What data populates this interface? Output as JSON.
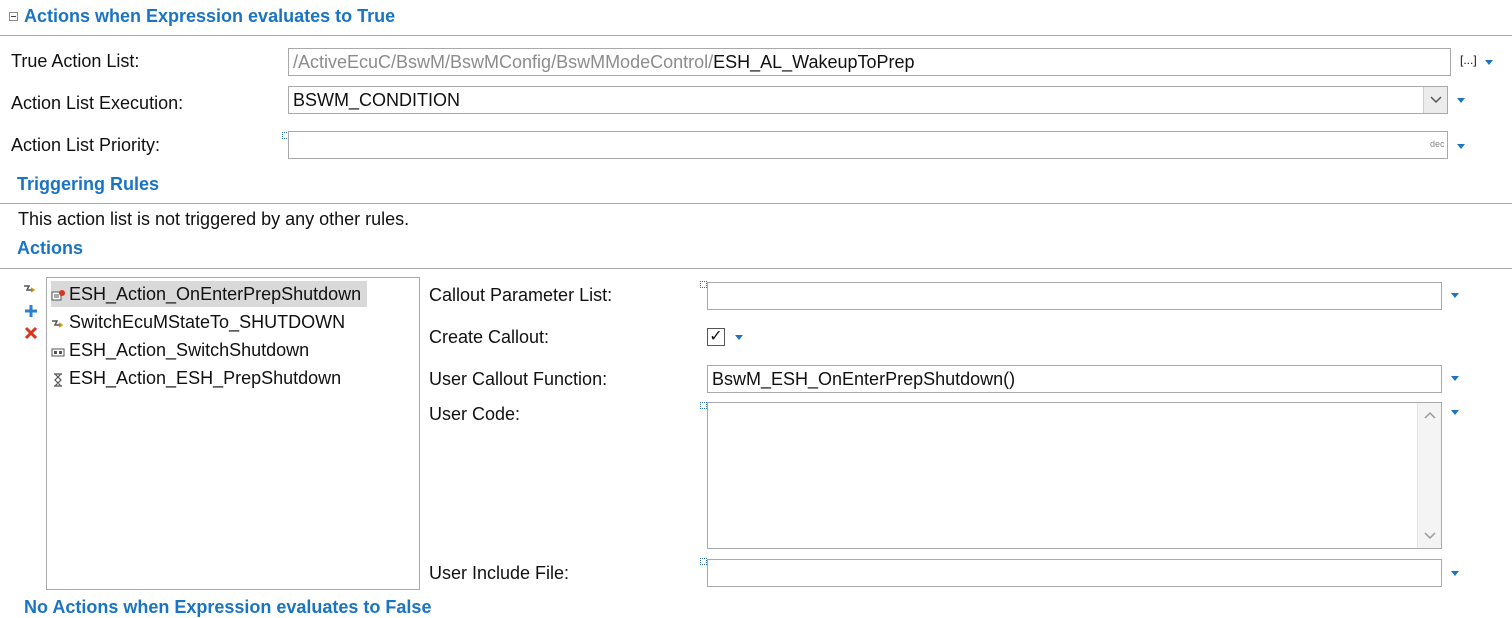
{
  "section_true": {
    "title": "Actions when Expression evaluates to True"
  },
  "true_action_list": {
    "label": "True Action List:",
    "path_prefix": "/ActiveEcuC/BswM/BswMConfig/BswMModeControl/",
    "path_value": "ESH_AL_WakeupToPrep",
    "browse": "[...]"
  },
  "action_list_execution": {
    "label": "Action List Execution:",
    "value": "BSWM_CONDITION"
  },
  "action_list_priority": {
    "label": "Action List Priority:",
    "value": "",
    "format": "dec"
  },
  "triggering_rules": {
    "title": "Triggering Rules",
    "text": "This action list is not triggered by any other rules."
  },
  "actions": {
    "title": "Actions",
    "items": [
      {
        "label": "ESH_Action_OnEnterPrepShutdown",
        "icon": "callout-icon",
        "selected": true
      },
      {
        "label": "SwitchEcuMStateTo_SHUTDOWN",
        "icon": "switch-action-icon",
        "selected": false
      },
      {
        "label": "ESH_Action_SwitchShutdown",
        "icon": "component-icon",
        "selected": false
      },
      {
        "label": "ESH_Action_ESH_PrepShutdown",
        "icon": "hourglass-icon",
        "selected": false
      }
    ]
  },
  "details": {
    "callout_parameter_list": {
      "label": "Callout Parameter List:",
      "value": ""
    },
    "create_callout": {
      "label": "Create Callout:",
      "checked": true,
      "check_glyph": "✓"
    },
    "user_callout_function": {
      "label": "User Callout Function:",
      "value": "BswM_ESH_OnEnterPrepShutdown()"
    },
    "user_code": {
      "label": "User Code:",
      "value": ""
    },
    "user_include_file": {
      "label": "User Include File:",
      "value": ""
    }
  },
  "section_false": {
    "title": "No Actions when Expression evaluates to False"
  },
  "colors": {
    "accent": "#1a74c4",
    "border": "#a9a9a9",
    "selection": "#d9d9d9",
    "delete": "#d9341c"
  }
}
